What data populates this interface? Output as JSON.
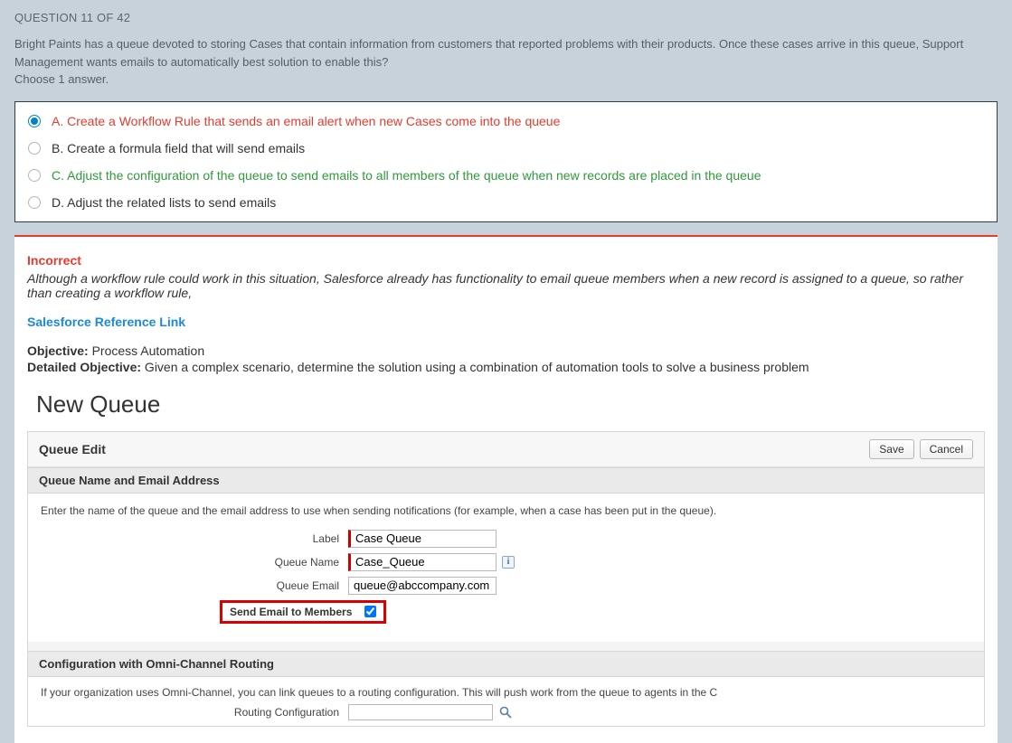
{
  "header": "QUESTION 11 OF 42",
  "prompt_line1": "Bright Paints has a queue devoted to storing Cases that contain information from customers that reported problems with their products. Once these cases arrive in this queue, Support Management wants emails to automatically best solution to enable this?",
  "prompt_line2": "Choose 1 answer.",
  "answers": {
    "a": "A. Create a Workflow Rule that sends an email alert when new Cases come into the queue",
    "b": "B. Create a formula field that will send emails",
    "c": "C. Adjust the configuration of the queue to send emails to all members of the queue when new records are placed in the queue",
    "d": "D. Adjust the related lists to send emails"
  },
  "feedback": {
    "label": "Incorrect",
    "text": "Although a workflow rule could work in this situation, Salesforce already has functionality to email queue members when a new record is assigned to a queue, so rather than creating a workflow rule,",
    "ref": "Salesforce Reference Link",
    "obj_label": "Objective:",
    "obj_text": " Process Automation",
    "dobj_label": "Detailed Objective:",
    "dobj_text": " Given a complex scenario, determine the solution using a combination of automation tools to solve a business problem"
  },
  "sf": {
    "title": "New Queue",
    "panel_title": "Queue Edit",
    "save": "Save",
    "cancel": "Cancel",
    "section1": "Queue Name and Email Address",
    "desc": "Enter the name of the queue and the email address to use when sending notifications (for example, when a case has been put in the queue).",
    "label_label": "Label",
    "label_value": "Case Queue",
    "qname_label": "Queue Name",
    "qname_value": "Case_Queue",
    "qemail_label": "Queue Email",
    "qemail_value": "queue@abccompany.com",
    "send_label": "Send Email to Members",
    "section2": "Configuration with Omni-Channel Routing",
    "omni_desc": "If your organization uses Omni-Channel, you can link queues to a routing configuration. This will push work from the queue to agents in the C",
    "routing_label": "Routing Configuration"
  }
}
